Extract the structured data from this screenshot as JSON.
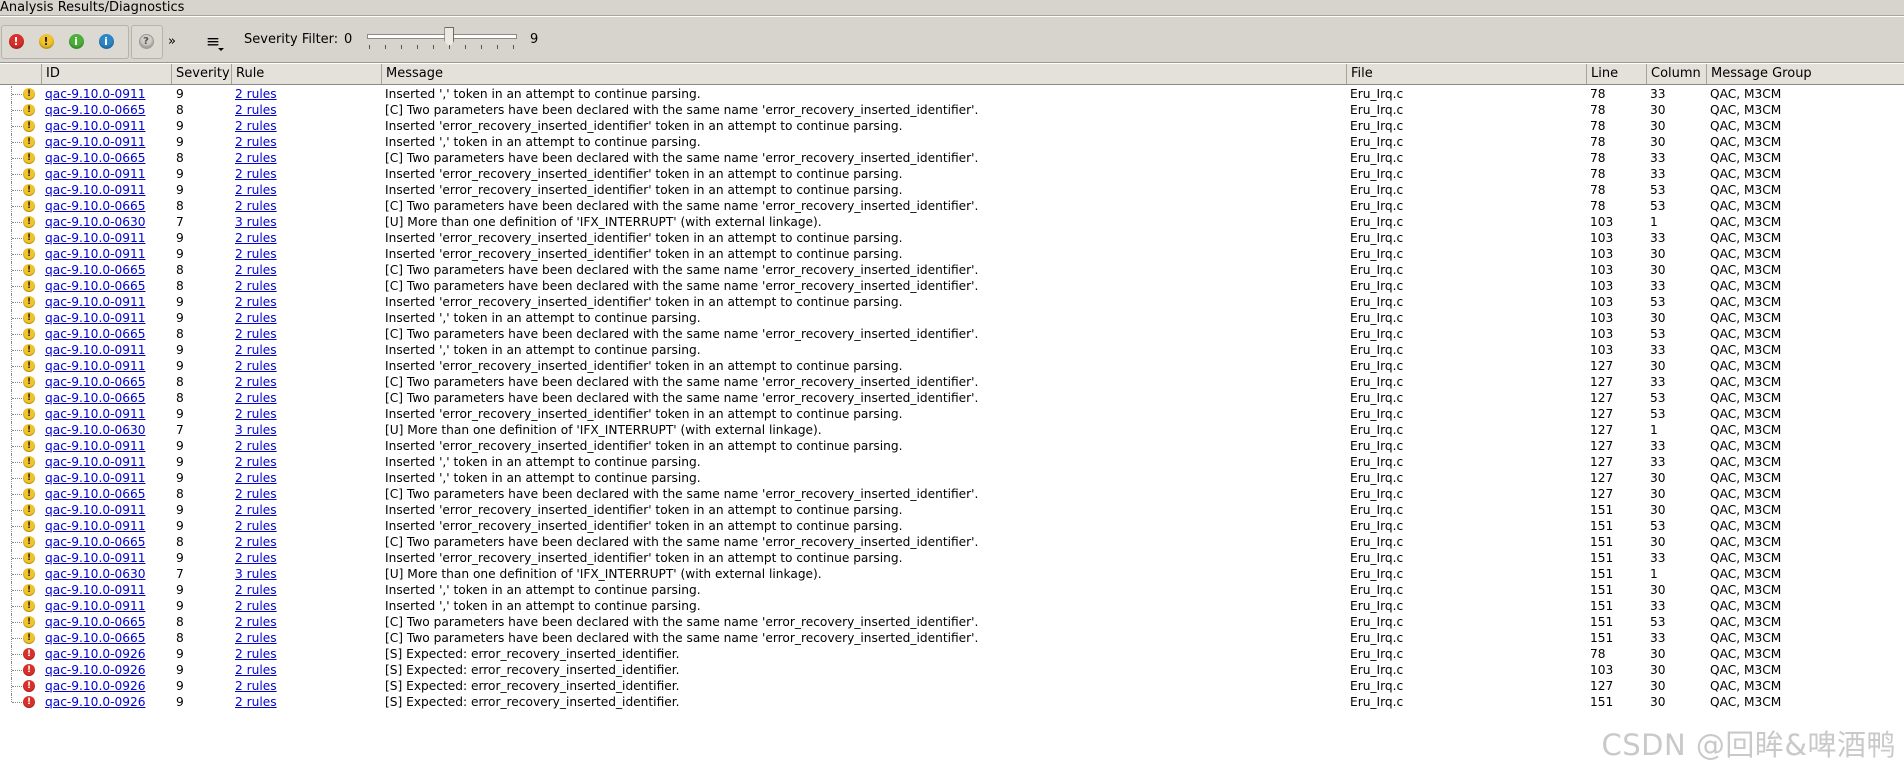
{
  "window": {
    "title": "Analysis Results/Diagnostics"
  },
  "toolbar": {
    "buttons": [
      {
        "name": "filter-error-button",
        "glyph": "!",
        "color": "#d9302c"
      },
      {
        "name": "filter-warning-button",
        "glyph": "!",
        "color": "#f2c32a"
      },
      {
        "name": "filter-info-button",
        "glyph": "i",
        "color": "#4db03a"
      },
      {
        "name": "filter-message-button",
        "glyph": "i",
        "color": "#2c86c8"
      }
    ],
    "help_glyph": "?",
    "more_glyph": "»",
    "menu_glyph": "≡",
    "severity_filter_label": "Severity Filter:",
    "severity_min": "0",
    "severity_max": "9",
    "severity_filter_value": 0.55
  },
  "table": {
    "columns": [
      "ID",
      "Severity",
      "Rule",
      "Message",
      "File",
      "Line",
      "Column",
      "Message Group"
    ],
    "rows": [
      {
        "icon": "warning",
        "id": "qac-9.10.0-0911",
        "severity": "9",
        "rule": "2 rules",
        "message": "Inserted ',' token in an attempt to continue parsing.",
        "file": "Eru_Irq.c",
        "line": "78",
        "column": "33",
        "group": "QAC, M3CM"
      },
      {
        "icon": "warning",
        "id": "qac-9.10.0-0665",
        "severity": "8",
        "rule": "2 rules",
        "message": "[C] Two parameters have been declared with the same name 'error_recovery_inserted_identifier'.",
        "file": "Eru_Irq.c",
        "line": "78",
        "column": "30",
        "group": "QAC, M3CM"
      },
      {
        "icon": "warning",
        "id": "qac-9.10.0-0911",
        "severity": "9",
        "rule": "2 rules",
        "message": "Inserted 'error_recovery_inserted_identifier' token in an attempt to continue parsing.",
        "file": "Eru_Irq.c",
        "line": "78",
        "column": "30",
        "group": "QAC, M3CM"
      },
      {
        "icon": "warning",
        "id": "qac-9.10.0-0911",
        "severity": "9",
        "rule": "2 rules",
        "message": "Inserted ',' token in an attempt to continue parsing.",
        "file": "Eru_Irq.c",
        "line": "78",
        "column": "30",
        "group": "QAC, M3CM"
      },
      {
        "icon": "warning",
        "id": "qac-9.10.0-0665",
        "severity": "8",
        "rule": "2 rules",
        "message": "[C] Two parameters have been declared with the same name 'error_recovery_inserted_identifier'.",
        "file": "Eru_Irq.c",
        "line": "78",
        "column": "33",
        "group": "QAC, M3CM"
      },
      {
        "icon": "warning",
        "id": "qac-9.10.0-0911",
        "severity": "9",
        "rule": "2 rules",
        "message": "Inserted 'error_recovery_inserted_identifier' token in an attempt to continue parsing.",
        "file": "Eru_Irq.c",
        "line": "78",
        "column": "33",
        "group": "QAC, M3CM"
      },
      {
        "icon": "warning",
        "id": "qac-9.10.0-0911",
        "severity": "9",
        "rule": "2 rules",
        "message": "Inserted 'error_recovery_inserted_identifier' token in an attempt to continue parsing.",
        "file": "Eru_Irq.c",
        "line": "78",
        "column": "53",
        "group": "QAC, M3CM"
      },
      {
        "icon": "warning",
        "id": "qac-9.10.0-0665",
        "severity": "8",
        "rule": "2 rules",
        "message": "[C] Two parameters have been declared with the same name 'error_recovery_inserted_identifier'.",
        "file": "Eru_Irq.c",
        "line": "78",
        "column": "53",
        "group": "QAC, M3CM"
      },
      {
        "icon": "warning",
        "id": "qac-9.10.0-0630",
        "severity": "7",
        "rule": "3 rules",
        "message": "[U] More than one definition of 'IFX_INTERRUPT' (with external linkage).",
        "file": "Eru_Irq.c",
        "line": "103",
        "column": "1",
        "group": "QAC, M3CM"
      },
      {
        "icon": "warning",
        "id": "qac-9.10.0-0911",
        "severity": "9",
        "rule": "2 rules",
        "message": "Inserted 'error_recovery_inserted_identifier' token in an attempt to continue parsing.",
        "file": "Eru_Irq.c",
        "line": "103",
        "column": "33",
        "group": "QAC, M3CM"
      },
      {
        "icon": "warning",
        "id": "qac-9.10.0-0911",
        "severity": "9",
        "rule": "2 rules",
        "message": "Inserted 'error_recovery_inserted_identifier' token in an attempt to continue parsing.",
        "file": "Eru_Irq.c",
        "line": "103",
        "column": "30",
        "group": "QAC, M3CM"
      },
      {
        "icon": "warning",
        "id": "qac-9.10.0-0665",
        "severity": "8",
        "rule": "2 rules",
        "message": "[C] Two parameters have been declared with the same name 'error_recovery_inserted_identifier'.",
        "file": "Eru_Irq.c",
        "line": "103",
        "column": "30",
        "group": "QAC, M3CM"
      },
      {
        "icon": "warning",
        "id": "qac-9.10.0-0665",
        "severity": "8",
        "rule": "2 rules",
        "message": "[C] Two parameters have been declared with the same name 'error_recovery_inserted_identifier'.",
        "file": "Eru_Irq.c",
        "line": "103",
        "column": "33",
        "group": "QAC, M3CM"
      },
      {
        "icon": "warning",
        "id": "qac-9.10.0-0911",
        "severity": "9",
        "rule": "2 rules",
        "message": "Inserted 'error_recovery_inserted_identifier' token in an attempt to continue parsing.",
        "file": "Eru_Irq.c",
        "line": "103",
        "column": "53",
        "group": "QAC, M3CM"
      },
      {
        "icon": "warning",
        "id": "qac-9.10.0-0911",
        "severity": "9",
        "rule": "2 rules",
        "message": "Inserted ',' token in an attempt to continue parsing.",
        "file": "Eru_Irq.c",
        "line": "103",
        "column": "30",
        "group": "QAC, M3CM"
      },
      {
        "icon": "warning",
        "id": "qac-9.10.0-0665",
        "severity": "8",
        "rule": "2 rules",
        "message": "[C] Two parameters have been declared with the same name 'error_recovery_inserted_identifier'.",
        "file": "Eru_Irq.c",
        "line": "103",
        "column": "53",
        "group": "QAC, M3CM"
      },
      {
        "icon": "warning",
        "id": "qac-9.10.0-0911",
        "severity": "9",
        "rule": "2 rules",
        "message": "Inserted ',' token in an attempt to continue parsing.",
        "file": "Eru_Irq.c",
        "line": "103",
        "column": "33",
        "group": "QAC, M3CM"
      },
      {
        "icon": "warning",
        "id": "qac-9.10.0-0911",
        "severity": "9",
        "rule": "2 rules",
        "message": "Inserted 'error_recovery_inserted_identifier' token in an attempt to continue parsing.",
        "file": "Eru_Irq.c",
        "line": "127",
        "column": "30",
        "group": "QAC, M3CM"
      },
      {
        "icon": "warning",
        "id": "qac-9.10.0-0665",
        "severity": "8",
        "rule": "2 rules",
        "message": "[C] Two parameters have been declared with the same name 'error_recovery_inserted_identifier'.",
        "file": "Eru_Irq.c",
        "line": "127",
        "column": "33",
        "group": "QAC, M3CM"
      },
      {
        "icon": "warning",
        "id": "qac-9.10.0-0665",
        "severity": "8",
        "rule": "2 rules",
        "message": "[C] Two parameters have been declared with the same name 'error_recovery_inserted_identifier'.",
        "file": "Eru_Irq.c",
        "line": "127",
        "column": "53",
        "group": "QAC, M3CM"
      },
      {
        "icon": "warning",
        "id": "qac-9.10.0-0911",
        "severity": "9",
        "rule": "2 rules",
        "message": "Inserted 'error_recovery_inserted_identifier' token in an attempt to continue parsing.",
        "file": "Eru_Irq.c",
        "line": "127",
        "column": "53",
        "group": "QAC, M3CM"
      },
      {
        "icon": "warning",
        "id": "qac-9.10.0-0630",
        "severity": "7",
        "rule": "3 rules",
        "message": "[U] More than one definition of 'IFX_INTERRUPT' (with external linkage).",
        "file": "Eru_Irq.c",
        "line": "127",
        "column": "1",
        "group": "QAC, M3CM"
      },
      {
        "icon": "warning",
        "id": "qac-9.10.0-0911",
        "severity": "9",
        "rule": "2 rules",
        "message": "Inserted 'error_recovery_inserted_identifier' token in an attempt to continue parsing.",
        "file": "Eru_Irq.c",
        "line": "127",
        "column": "33",
        "group": "QAC, M3CM"
      },
      {
        "icon": "warning",
        "id": "qac-9.10.0-0911",
        "severity": "9",
        "rule": "2 rules",
        "message": "Inserted ',' token in an attempt to continue parsing.",
        "file": "Eru_Irq.c",
        "line": "127",
        "column": "33",
        "group": "QAC, M3CM"
      },
      {
        "icon": "warning",
        "id": "qac-9.10.0-0911",
        "severity": "9",
        "rule": "2 rules",
        "message": "Inserted ',' token in an attempt to continue parsing.",
        "file": "Eru_Irq.c",
        "line": "127",
        "column": "30",
        "group": "QAC, M3CM"
      },
      {
        "icon": "warning",
        "id": "qac-9.10.0-0665",
        "severity": "8",
        "rule": "2 rules",
        "message": "[C] Two parameters have been declared with the same name 'error_recovery_inserted_identifier'.",
        "file": "Eru_Irq.c",
        "line": "127",
        "column": "30",
        "group": "QAC, M3CM"
      },
      {
        "icon": "warning",
        "id": "qac-9.10.0-0911",
        "severity": "9",
        "rule": "2 rules",
        "message": "Inserted 'error_recovery_inserted_identifier' token in an attempt to continue parsing.",
        "file": "Eru_Irq.c",
        "line": "151",
        "column": "30",
        "group": "QAC, M3CM"
      },
      {
        "icon": "warning",
        "id": "qac-9.10.0-0911",
        "severity": "9",
        "rule": "2 rules",
        "message": "Inserted 'error_recovery_inserted_identifier' token in an attempt to continue parsing.",
        "file": "Eru_Irq.c",
        "line": "151",
        "column": "53",
        "group": "QAC, M3CM"
      },
      {
        "icon": "warning",
        "id": "qac-9.10.0-0665",
        "severity": "8",
        "rule": "2 rules",
        "message": "[C] Two parameters have been declared with the same name 'error_recovery_inserted_identifier'.",
        "file": "Eru_Irq.c",
        "line": "151",
        "column": "30",
        "group": "QAC, M3CM"
      },
      {
        "icon": "warning",
        "id": "qac-9.10.0-0911",
        "severity": "9",
        "rule": "2 rules",
        "message": "Inserted 'error_recovery_inserted_identifier' token in an attempt to continue parsing.",
        "file": "Eru_Irq.c",
        "line": "151",
        "column": "33",
        "group": "QAC, M3CM"
      },
      {
        "icon": "warning",
        "id": "qac-9.10.0-0630",
        "severity": "7",
        "rule": "3 rules",
        "message": "[U] More than one definition of 'IFX_INTERRUPT' (with external linkage).",
        "file": "Eru_Irq.c",
        "line": "151",
        "column": "1",
        "group": "QAC, M3CM"
      },
      {
        "icon": "warning",
        "id": "qac-9.10.0-0911",
        "severity": "9",
        "rule": "2 rules",
        "message": "Inserted ',' token in an attempt to continue parsing.",
        "file": "Eru_Irq.c",
        "line": "151",
        "column": "30",
        "group": "QAC, M3CM"
      },
      {
        "icon": "warning",
        "id": "qac-9.10.0-0911",
        "severity": "9",
        "rule": "2 rules",
        "message": "Inserted ',' token in an attempt to continue parsing.",
        "file": "Eru_Irq.c",
        "line": "151",
        "column": "33",
        "group": "QAC, M3CM"
      },
      {
        "icon": "warning",
        "id": "qac-9.10.0-0665",
        "severity": "8",
        "rule": "2 rules",
        "message": "[C] Two parameters have been declared with the same name 'error_recovery_inserted_identifier'.",
        "file": "Eru_Irq.c",
        "line": "151",
        "column": "53",
        "group": "QAC, M3CM"
      },
      {
        "icon": "warning",
        "id": "qac-9.10.0-0665",
        "severity": "8",
        "rule": "2 rules",
        "message": "[C] Two parameters have been declared with the same name 'error_recovery_inserted_identifier'.",
        "file": "Eru_Irq.c",
        "line": "151",
        "column": "33",
        "group": "QAC, M3CM"
      },
      {
        "icon": "error",
        "id": "qac-9.10.0-0926",
        "severity": "9",
        "rule": "2 rules",
        "message": "[S] Expected: error_recovery_inserted_identifier.",
        "file": "Eru_Irq.c",
        "line": "78",
        "column": "30",
        "group": "QAC, M3CM"
      },
      {
        "icon": "error",
        "id": "qac-9.10.0-0926",
        "severity": "9",
        "rule": "2 rules",
        "message": "[S] Expected: error_recovery_inserted_identifier.",
        "file": "Eru_Irq.c",
        "line": "103",
        "column": "30",
        "group": "QAC, M3CM"
      },
      {
        "icon": "error",
        "id": "qac-9.10.0-0926",
        "severity": "9",
        "rule": "2 rules",
        "message": "[S] Expected: error_recovery_inserted_identifier.",
        "file": "Eru_Irq.c",
        "line": "127",
        "column": "30",
        "group": "QAC, M3CM"
      },
      {
        "icon": "error",
        "id": "qac-9.10.0-0926",
        "severity": "9",
        "rule": "2 rules",
        "message": "[S] Expected: error_recovery_inserted_identifier.",
        "file": "Eru_Irq.c",
        "line": "151",
        "column": "30",
        "group": "QAC, M3CM"
      }
    ]
  },
  "colors": {
    "warning": "#f2c32a",
    "error": "#d9302c",
    "link": "#0000d0"
  },
  "watermark": "CSDN @回眸&啤酒鸭"
}
